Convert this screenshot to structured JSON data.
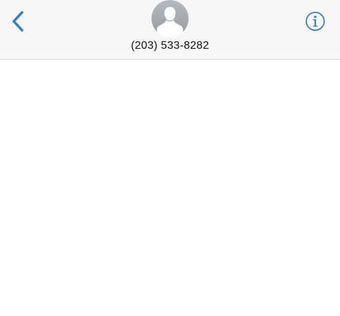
{
  "header": {
    "contact_name": "(203) 533-8282",
    "back_icon": "chevron-left-icon",
    "info_icon": "info-circle-icon",
    "avatar_icon": "person-silhouette-icon"
  },
  "colors": {
    "accent": "#2f7fd8",
    "header_background": "#f7f7f7",
    "avatar_gray": "#a7a9b0",
    "divider": "#d6d6d6"
  },
  "conversation": {
    "messages": []
  }
}
